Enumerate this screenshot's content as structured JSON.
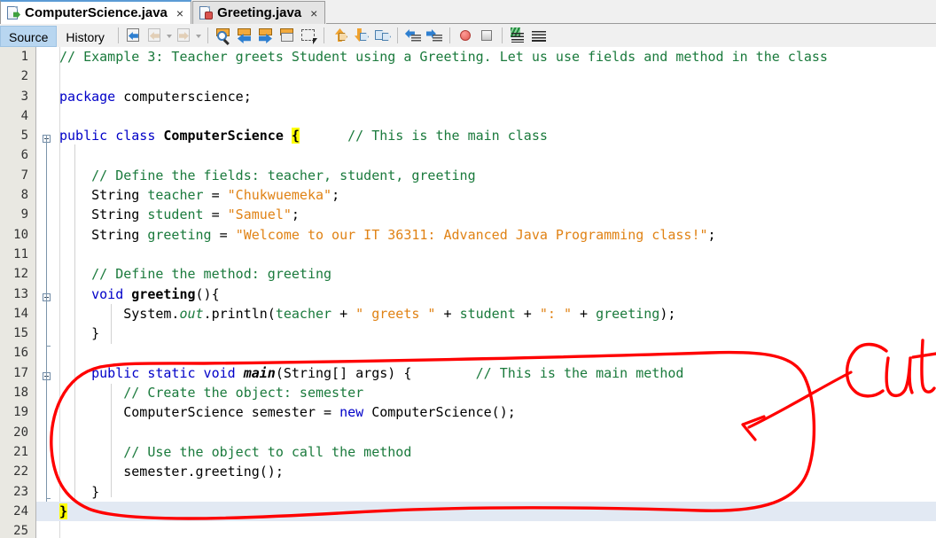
{
  "window": {
    "app": "NetBeans Java Editor"
  },
  "tabs": [
    {
      "label": "ComputerScience.java",
      "icon": "java-file-icon",
      "close": "×",
      "active": true
    },
    {
      "label": "Greeting.java",
      "icon": "java-file-icon",
      "close": "×",
      "active": false
    }
  ],
  "toolbar": {
    "view_tabs": [
      {
        "label": "Source",
        "selected": true
      },
      {
        "label": "History",
        "selected": false
      }
    ],
    "buttons": [
      {
        "name": "last-edit-icon",
        "enabled": true
      },
      {
        "name": "back-icon",
        "enabled": false
      },
      {
        "name": "back-dropdown-caret-icon",
        "enabled": false
      },
      {
        "name": "forward-icon",
        "enabled": false
      },
      {
        "name": "forward-dropdown-caret-icon",
        "enabled": false
      },
      {
        "name": "find-selection-icon",
        "enabled": true
      },
      {
        "name": "find-previous-icon",
        "enabled": true
      },
      {
        "name": "find-next-icon",
        "enabled": true
      },
      {
        "name": "toggle-highlight-icon",
        "enabled": true
      },
      {
        "name": "toggle-rectangular-selection-icon",
        "enabled": true
      },
      {
        "name": "previous-bookmark-icon",
        "enabled": true
      },
      {
        "name": "next-bookmark-icon",
        "enabled": true
      },
      {
        "name": "toggle-bookmark-icon",
        "enabled": true
      },
      {
        "name": "shift-line-left-icon",
        "enabled": true
      },
      {
        "name": "shift-line-right-icon",
        "enabled": true
      },
      {
        "name": "start-macro-recording-icon",
        "enabled": true
      },
      {
        "name": "stop-macro-recording-icon",
        "enabled": true
      },
      {
        "name": "comment-icon",
        "enabled": true
      },
      {
        "name": "uncomment-icon",
        "enabled": true
      }
    ]
  },
  "editor": {
    "current_line": 24,
    "lines": [
      {
        "n": 1,
        "text": "// Example 3: Teacher greets Student using a Greeting. Let us use fields and method in the class"
      },
      {
        "n": 2,
        "text": ""
      },
      {
        "n": 3,
        "text": "package computerscience;"
      },
      {
        "n": 4,
        "text": ""
      },
      {
        "n": 5,
        "text": "public class ComputerScience {      // This is the main class"
      },
      {
        "n": 6,
        "text": ""
      },
      {
        "n": 7,
        "text": "    // Define the fields: teacher, student, greeting"
      },
      {
        "n": 8,
        "text": "    String teacher = \"Chukwuemeka\";"
      },
      {
        "n": 9,
        "text": "    String student = \"Samuel\";"
      },
      {
        "n": 10,
        "text": "    String greeting = \"Welcome to our IT 36311: Advanced Java Programming class!\";"
      },
      {
        "n": 11,
        "text": ""
      },
      {
        "n": 12,
        "text": "    // Define the method: greeting"
      },
      {
        "n": 13,
        "text": "    void greeting(){"
      },
      {
        "n": 14,
        "text": "        System.out.println(teacher + \" greets \" + student + \": \" + greeting);"
      },
      {
        "n": 15,
        "text": "    }"
      },
      {
        "n": 16,
        "text": ""
      },
      {
        "n": 17,
        "text": "    public static void main(String[] args) {        // This is the main method"
      },
      {
        "n": 18,
        "text": "        // Create the object: semester"
      },
      {
        "n": 19,
        "text": "        ComputerScience semester = new ComputerScience();"
      },
      {
        "n": 20,
        "text": ""
      },
      {
        "n": 21,
        "text": "        // Use the object to call the method"
      },
      {
        "n": 22,
        "text": "        semester.greeting();"
      },
      {
        "n": 23,
        "text": "    }"
      },
      {
        "n": 24,
        "text": "}"
      },
      {
        "n": 25,
        "text": ""
      }
    ]
  },
  "annotation": {
    "label": "Cut",
    "color": "#ff0000",
    "shape": "ellipse-with-arrow",
    "encircles_lines": "17-24"
  },
  "colors": {
    "keyword": "#0000c8",
    "comment": "#1a7a3c",
    "string": "#e08214",
    "field": "#1a7a3c",
    "brace_highlight": "#ffff00",
    "current_line": "#e2e9f3",
    "annotation_red": "#ff0000"
  }
}
